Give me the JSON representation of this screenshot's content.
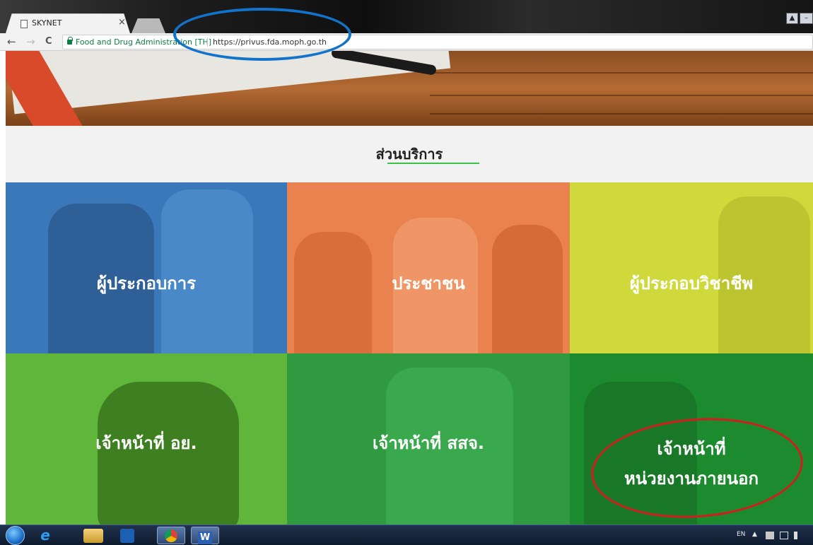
{
  "browser": {
    "tab_title": "SKYNET",
    "tab_close": "×",
    "back": "←",
    "forward": "→",
    "reload": "C",
    "site_name": "Food and Drug Administration [TH]",
    "url": "https://privus.fda.moph.go.th",
    "window_buttons": [
      "▲",
      "–"
    ]
  },
  "section": {
    "title": "ส่วนบริการ",
    "underline_color": "#39c24a"
  },
  "tiles": [
    {
      "label": "ผู้ประกอบการ",
      "color": "#3a78b9"
    },
    {
      "label": "ประชาชน",
      "color": "#ea8250"
    },
    {
      "label": "ผู้ประกอบวิชาชีพ",
      "color": "#cfd93b"
    },
    {
      "label": "เจ้าหน้าที่ อย.",
      "color": "#5fb63a"
    },
    {
      "label": "เจ้าหน้าที่ สสจ.",
      "color": "#2f9a40"
    },
    {
      "label_line1": "เจ้าหน้าที่",
      "label_line2": "หน่วยงานภายนอก",
      "color": "#1c8a2e"
    }
  ],
  "annotations": {
    "url_circle_color": "#1173c9",
    "tile_circle_color": "#d21d1d"
  },
  "taskbar": {
    "apps": [
      "ie-icon",
      "explorer-icon",
      "media-player-icon",
      "chrome-icon",
      "word-icon"
    ],
    "word_label": "W",
    "ie_label": "e",
    "language": "EN",
    "tray_up": "▲"
  }
}
